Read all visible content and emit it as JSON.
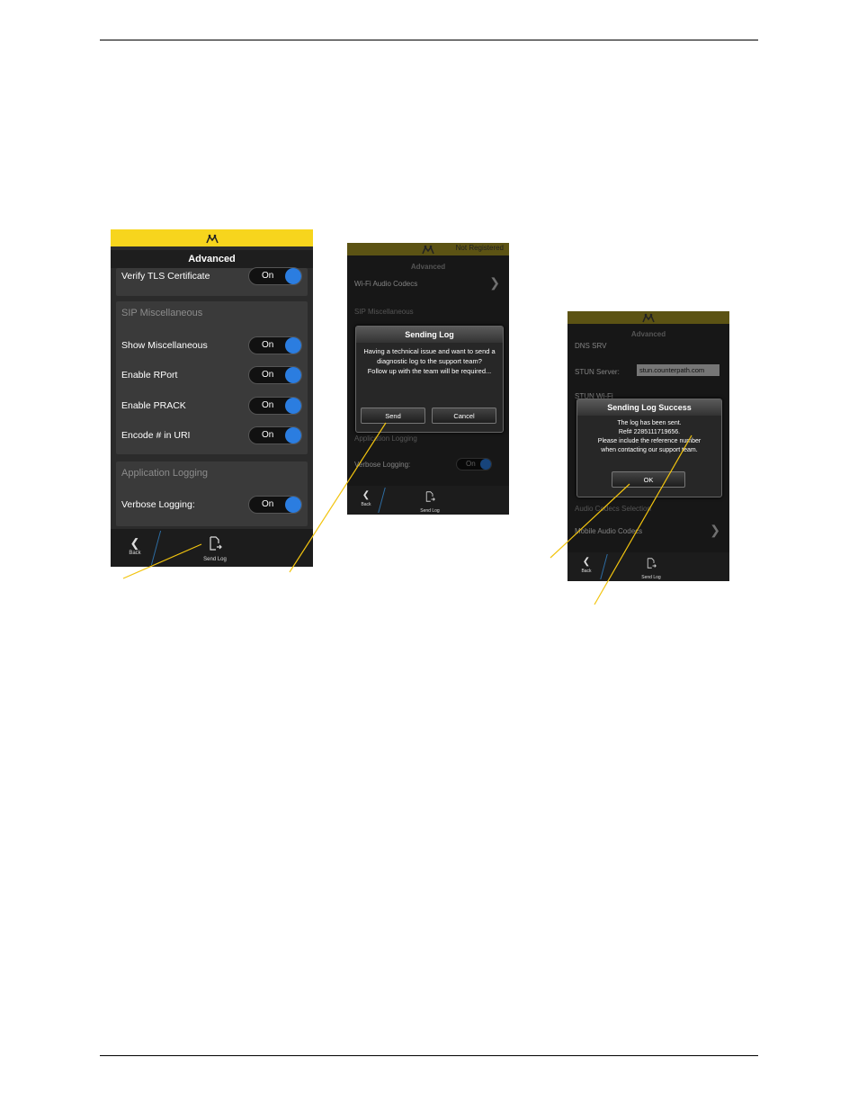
{
  "screen1": {
    "title": "Advanced",
    "rows": [
      {
        "label": "Verify TLS Certificate",
        "value": "On"
      },
      {
        "label": "Show Miscellaneous",
        "value": "On"
      },
      {
        "label": "Enable RPort",
        "value": "On"
      },
      {
        "label": "Enable PRACK",
        "value": "On"
      },
      {
        "label": "Encode # in URI",
        "value": "On"
      },
      {
        "label": "Verbose Logging:",
        "value": "On"
      }
    ],
    "sections": [
      "SIP Miscellaneous",
      "Application Logging"
    ],
    "bottom": {
      "back": "Back",
      "send_log": "Send Log"
    }
  },
  "screen2": {
    "status": "Not Registered",
    "title": "Advanced",
    "bg_items": [
      "Wi-Fi Audio Codecs",
      "SIP Miscellaneous",
      "Application Logging",
      "Verbose Logging:"
    ],
    "toggle_value": "On",
    "dialog": {
      "title": "Sending Log",
      "body": "Having a technical issue and want to send a diagnostic log to the support team?\nFollow up with the team will be required...",
      "send": "Send",
      "cancel": "Cancel"
    },
    "bottom": {
      "back": "Back",
      "send_log": "Send Log"
    }
  },
  "screen3": {
    "title": "Advanced",
    "bg_items": [
      "DNS SRV",
      "STUN Server:",
      "STUN Wi-Fi",
      "Audio Codecs Selection",
      "Mobile Audio Codecs"
    ],
    "stun_value": "stun.counterpath.com",
    "dialog": {
      "title": "Sending Log Success",
      "line1": "The log has been sent.",
      "line2": "Ref# 2285111719656.",
      "line3": "Please include the reference number",
      "line4": "when contacting our support team.",
      "ok": "OK"
    },
    "bottom": {
      "back": "Back",
      "send_log": "Send Log"
    }
  },
  "colors": {
    "brand_yellow": "#f7d51d",
    "toggle_blue": "#2b7de0",
    "callout": "#f2c40f"
  }
}
